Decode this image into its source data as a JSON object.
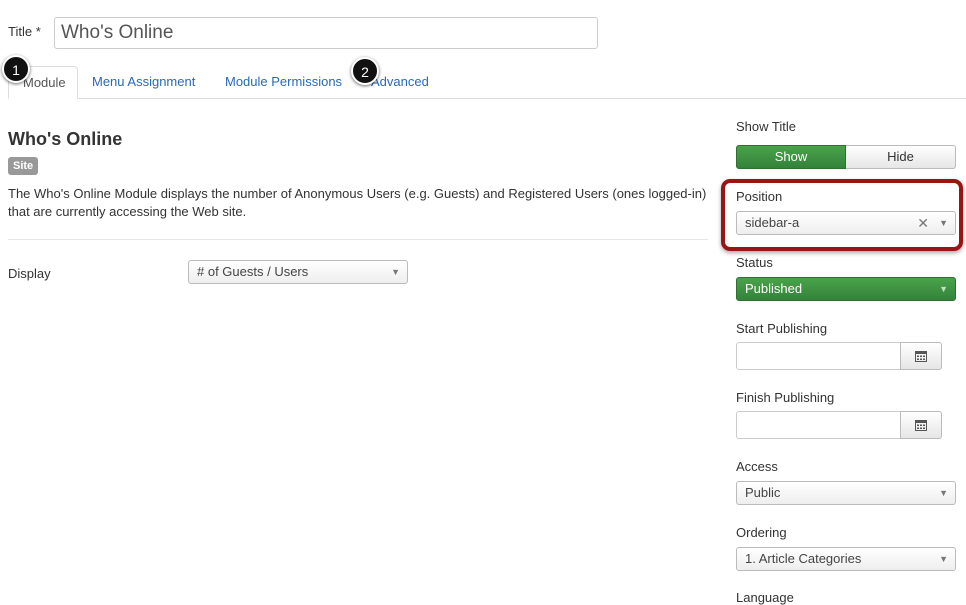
{
  "title_field": {
    "label": "Title *",
    "value": "Who's Online"
  },
  "tabs": [
    {
      "label": "Module"
    },
    {
      "label": "Menu Assignment"
    },
    {
      "label": "Module Permissions"
    },
    {
      "label": "Advanced"
    }
  ],
  "markers": [
    "1",
    "2"
  ],
  "module": {
    "heading": "Who's Online",
    "badge": "Site",
    "description": "The Who's Online Module displays the number of Anonymous Users (e.g. Guests) and Registered Users (ones logged-in) that are currently accessing the Web site.",
    "display_label": "Display",
    "display_value": "# of Guests / Users"
  },
  "sidebar": {
    "show_title_label": "Show Title",
    "show_label": "Show",
    "hide_label": "Hide",
    "position_label": "Position",
    "position_value": "sidebar-a",
    "status_label": "Status",
    "status_value": "Published",
    "start_label": "Start Publishing",
    "finish_label": "Finish Publishing",
    "access_label": "Access",
    "access_value": "Public",
    "ordering_label": "Ordering",
    "ordering_value": "1. Article Categories",
    "language_label": "Language"
  },
  "colors": {
    "active_green": "#3a8a3a",
    "highlight_red": "#9b1414",
    "link_blue": "#2a69b8"
  }
}
